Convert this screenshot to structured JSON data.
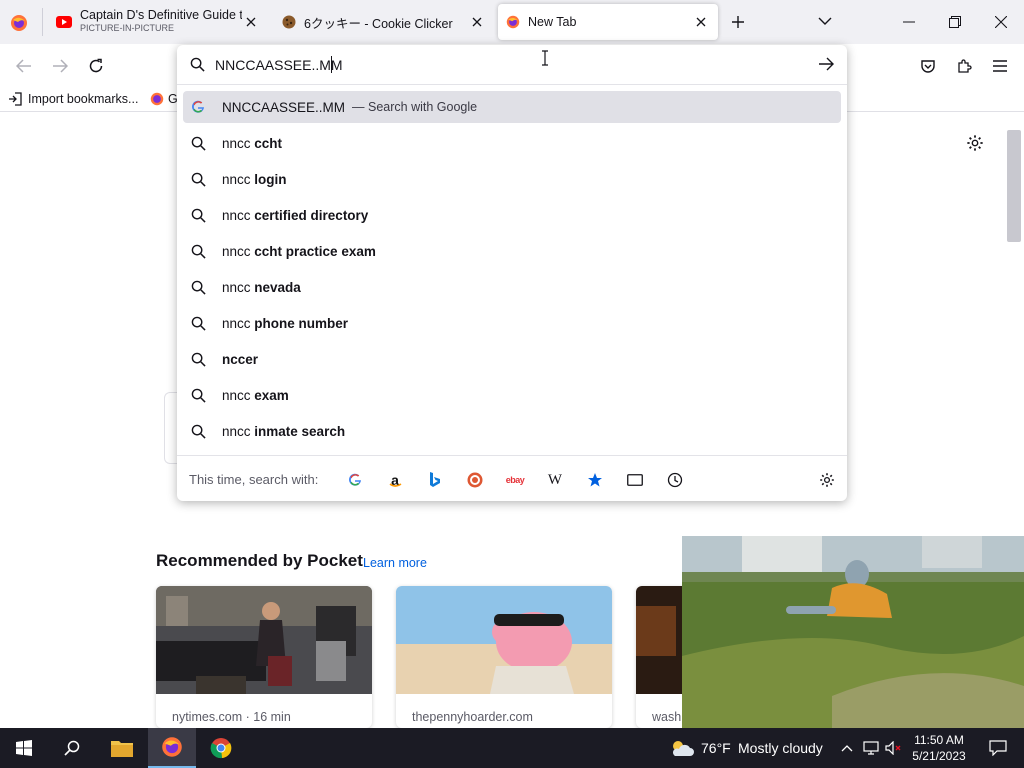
{
  "tabs": [
    {
      "title": "Captain D's Definitive Guide to",
      "subtitle": "PICTURE-IN-PICTURE",
      "icon": "youtube-icon"
    },
    {
      "title": "6クッキー - Cookie Clicker",
      "icon": "cookie-icon"
    },
    {
      "title": "New Tab",
      "icon": "firefox-icon",
      "selected": true
    }
  ],
  "urlbar": {
    "value": "NNCCAASSEE..MM"
  },
  "bookmarks": {
    "import_label": "Import bookmarks...",
    "second_label": "G"
  },
  "suggestions": {
    "first": {
      "query": "NNCCAASSEE..MM",
      "action": "— Search with Google"
    },
    "items": [
      {
        "prefix": "nncc ",
        "bold": "ccht"
      },
      {
        "prefix": "nncc ",
        "bold": "login"
      },
      {
        "prefix": "nncc ",
        "bold": "certified directory"
      },
      {
        "prefix": "nncc ",
        "bold": "ccht practice exam"
      },
      {
        "prefix": "nncc ",
        "bold": "nevada"
      },
      {
        "prefix": "nncc ",
        "bold": "phone number"
      },
      {
        "prefix": "",
        "bold": "nccer"
      },
      {
        "prefix": "nncc ",
        "bold": "exam"
      },
      {
        "prefix": "nncc ",
        "bold": "inmate search"
      }
    ]
  },
  "oneoff": {
    "label": "This time, search with:",
    "engines": [
      "google-icon",
      "amazon-icon",
      "bing-icon",
      "duckduckgo-icon",
      "ebay-icon",
      "wikipedia-icon",
      "bookmarks-star-icon",
      "tabs-icon",
      "history-icon"
    ],
    "amazon_glyph": "a",
    "ebay_glyph": "ebay",
    "wikipedia_glyph": "W"
  },
  "pocket": {
    "heading": "Recommended by Pocket",
    "learn_more": "Learn more",
    "cards": [
      {
        "source": "nytimes.com · 16 min"
      },
      {
        "source": "thepennyhoarder.com"
      },
      {
        "source": "wash"
      }
    ]
  },
  "taskbar": {
    "weather_temp": "76°F",
    "weather_text": "Mostly cloudy",
    "time": "11:50 AM",
    "date": "5/21/2023"
  },
  "colors": {
    "accent": "#0060df",
    "tabstrip": "#f0f0f4",
    "taskbar": "#1b1b24"
  }
}
